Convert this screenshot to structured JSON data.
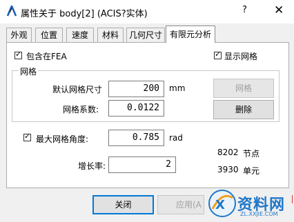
{
  "window": {
    "title": "属性关于 body[2] (ACIS?实体)",
    "help_label": "?",
    "close_label": "✕"
  },
  "tabs": [
    {
      "label": "外观"
    },
    {
      "label": "位置"
    },
    {
      "label": "速度"
    },
    {
      "label": "材料"
    },
    {
      "label": "几何尺寸"
    },
    {
      "label": "有限元分析",
      "active": true
    }
  ],
  "fea": {
    "include_fea_label": "包含在FEA",
    "include_fea_checked": true,
    "show_mesh_label": "显示网格",
    "show_mesh_checked": true
  },
  "mesh": {
    "group_title": "网格",
    "default_size_label": "默认网格尺寸",
    "default_size_value": "200",
    "default_size_unit": "mm",
    "coefficient_label": "网格系数:",
    "coefficient_value": "0.0122",
    "mesh_button": "网格",
    "delete_button": "删除"
  },
  "angle": {
    "label": "最大网格角度:",
    "checked": true,
    "value": "0.785",
    "unit": "rad"
  },
  "growth": {
    "label": "增长率:",
    "value": "2"
  },
  "stats": {
    "nodes_count": "8202",
    "nodes_label": "节点",
    "elements_count": "3930",
    "elements_label": "单元"
  },
  "footer": {
    "close_button": "关闭",
    "apply_button": "应用(A"
  },
  "watermark": {
    "text": "资料网",
    "url": "ZL.XXJIE.COM"
  },
  "colors": {
    "accent": "#0078d7",
    "watermark": "#1f77c9"
  }
}
